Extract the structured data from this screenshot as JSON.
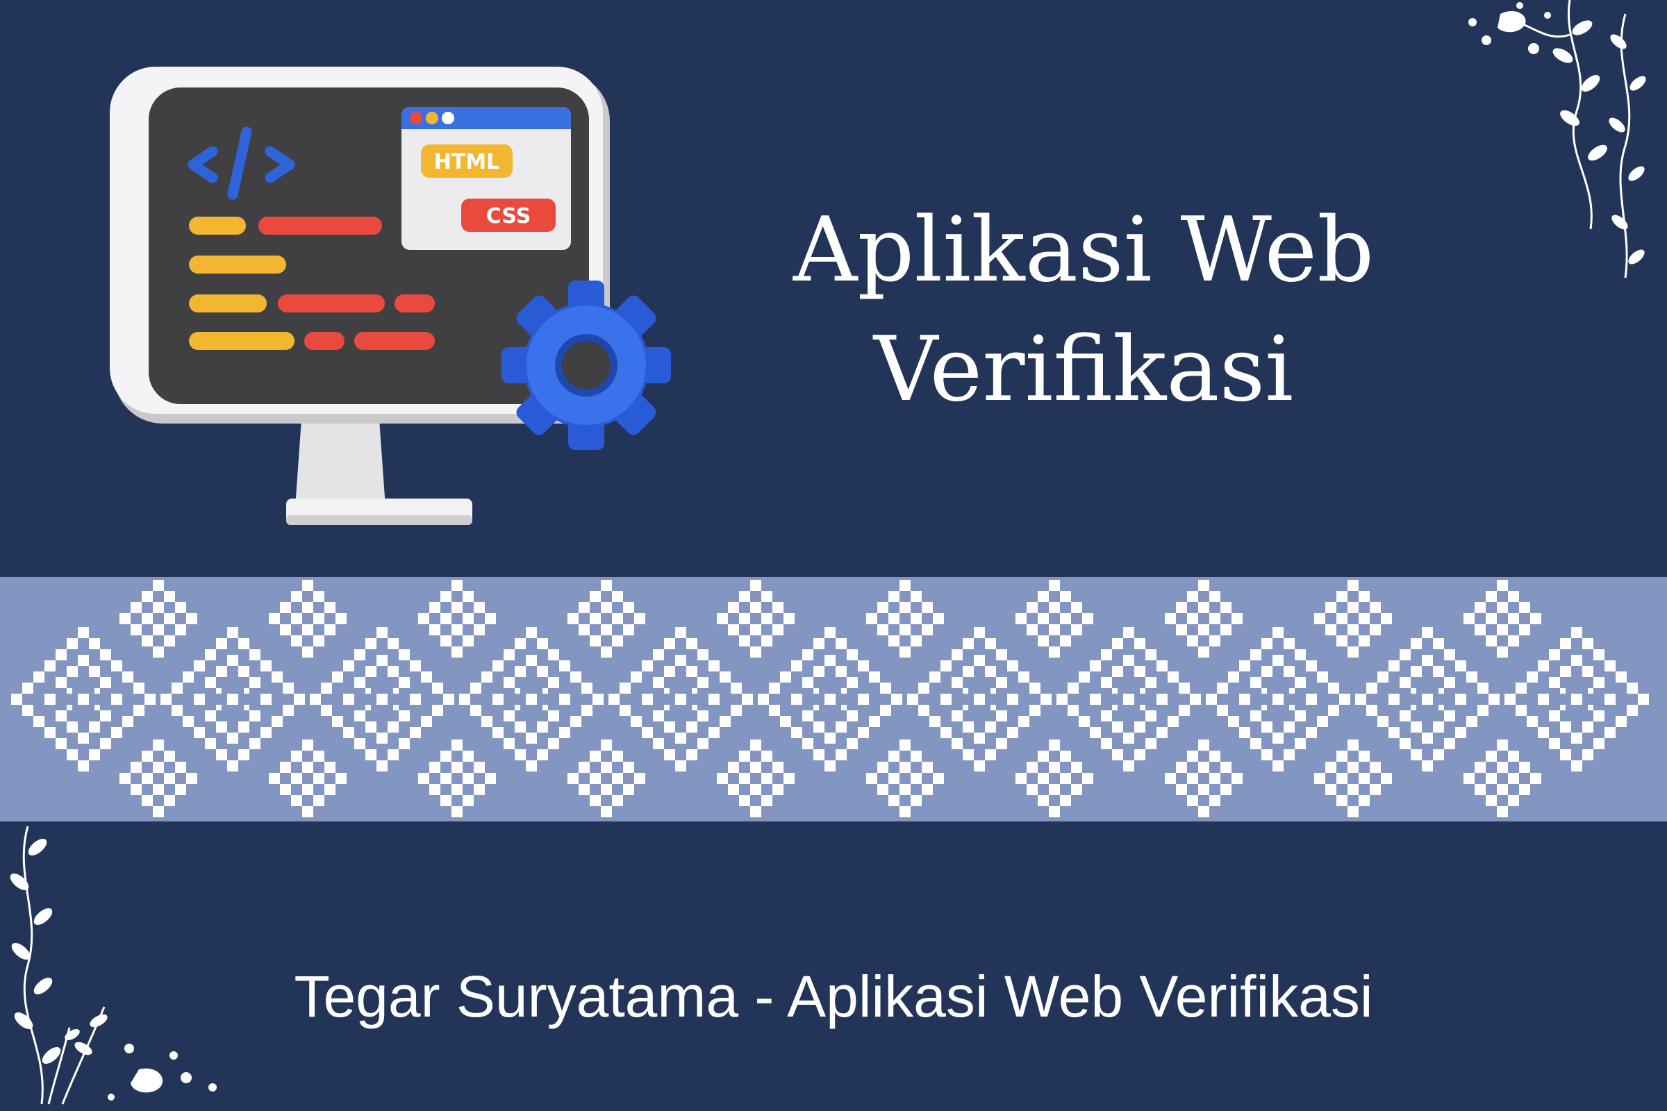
{
  "title": {
    "line1": "Aplikasi Web",
    "line2": "Verifikasi"
  },
  "caption": "Tegar Suryatama - Aplikasi Web Verifikasi",
  "illustration": {
    "window_badge_html": "HTML",
    "window_badge_css": "CSS",
    "code_icon": "code-brackets-icon",
    "gear_icon": "gear-icon"
  },
  "colors": {
    "background": "#223558",
    "band": "#8396c1",
    "pattern": "#ffffff",
    "text": "#ffffff"
  }
}
